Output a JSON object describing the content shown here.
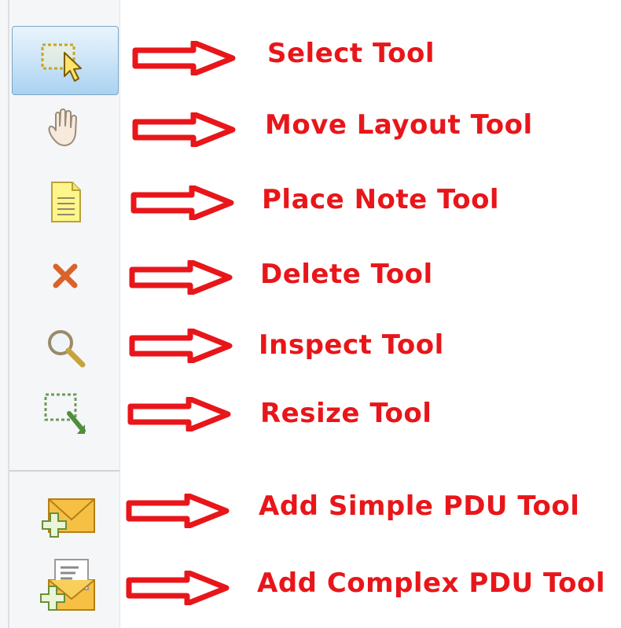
{
  "tools": [
    {
      "key": "select",
      "label": "Select Tool",
      "icon": "select-icon",
      "active": true
    },
    {
      "key": "move-layout",
      "label": "Move Layout Tool",
      "icon": "hand-icon",
      "active": false
    },
    {
      "key": "place-note",
      "label": "Place Note Tool",
      "icon": "note-icon",
      "active": false
    },
    {
      "key": "delete",
      "label": "Delete Tool",
      "icon": "delete-x-icon",
      "active": false
    },
    {
      "key": "inspect",
      "label": "Inspect Tool",
      "icon": "magnifier-icon",
      "active": false
    },
    {
      "key": "resize",
      "label": "Resize Tool",
      "icon": "resize-icon",
      "active": false
    },
    {
      "key": "add-simple-pdu",
      "label": "Add Simple PDU Tool",
      "icon": "envelope-plus-icon",
      "active": false
    },
    {
      "key": "add-complex-pdu",
      "label": "Add Complex PDU Tool",
      "icon": "open-envelope-plus-icon",
      "active": false
    }
  ],
  "colors": {
    "annotation": "#e8161a",
    "active_tool_bg": "#bfe0f6",
    "toolbar_bg": "#f5f6f8"
  }
}
